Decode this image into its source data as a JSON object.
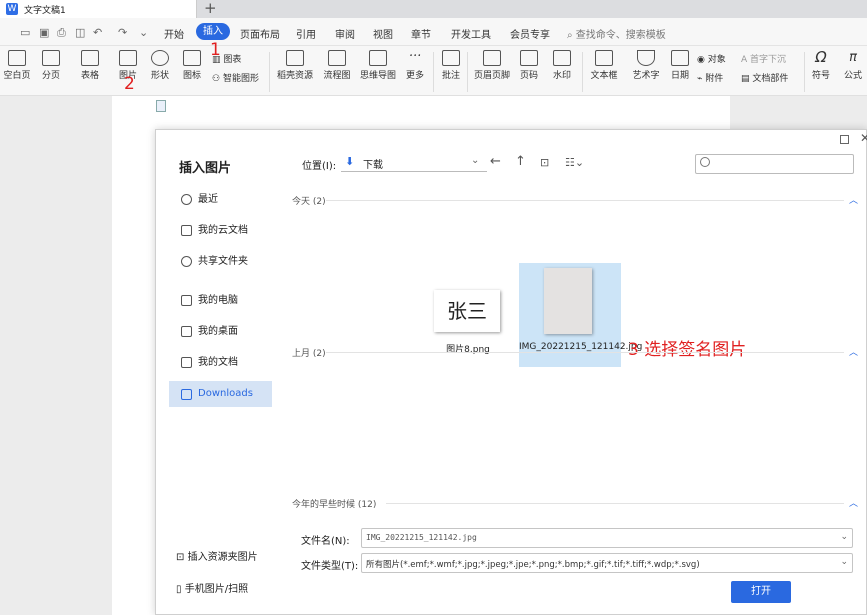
{
  "window": {
    "doc_tab": "文字文稿1",
    "new_tab": "+"
  },
  "menu": {
    "items": [
      "开始",
      "插入",
      "页面布局",
      "引用",
      "审阅",
      "视图",
      "章节",
      "开发工具",
      "会员专享"
    ],
    "active": "插入",
    "search_placeholder": "查找命令、搜索模板"
  },
  "ribbon": {
    "items": [
      "空白页",
      "分页",
      "表格",
      "图片",
      "形状",
      "图标",
      "图表",
      "智能图形",
      "稻壳资源",
      "流程图",
      "思维导图",
      "更多",
      "批注",
      "页眉页脚",
      "页码",
      "水印",
      "文本框",
      "艺术字",
      "日期",
      "对象",
      "附件",
      "首字下沉",
      "文档部件",
      "符号",
      "公式"
    ]
  },
  "annotations": {
    "step1": "1",
    "step2": "2",
    "step3": "3 选择签名图片"
  },
  "dialog": {
    "title": "插入图片",
    "location_label": "位置(I):",
    "location_value": "下载",
    "sidebar": [
      "最近",
      "我的云文档",
      "共享文件夹",
      "我的电脑",
      "我的桌面",
      "我的文档",
      "Downloads"
    ],
    "sidebar_selected": "Downloads",
    "sidebar_bottom": [
      "插入资源夹图片",
      "手机图片/扫照"
    ],
    "groups": [
      {
        "label": "今天 (2)"
      },
      {
        "label": "上月 (2)"
      },
      {
        "label": "今年的早些时候 (12)"
      }
    ],
    "files": [
      {
        "name": "图片8.png",
        "thumb_text": "张三"
      },
      {
        "name": "IMG_20221215_121142.jpg",
        "selected": true
      }
    ],
    "filename_label": "文件名(N):",
    "filename_value": "IMG_20221215_121142.jpg",
    "filetype_label": "文件类型(T):",
    "filetype_value": "所有图片(*.emf;*.wmf;*.jpg;*.jpeg;*.jpe;*.png;*.bmp;*.gif;*.tif;*.tiff;*.wdp;*.svg)",
    "open_button": "打开"
  },
  "colors": {
    "accent": "#2a69e0",
    "annotation_red": "#e02020",
    "selection": "#cce4f7"
  }
}
